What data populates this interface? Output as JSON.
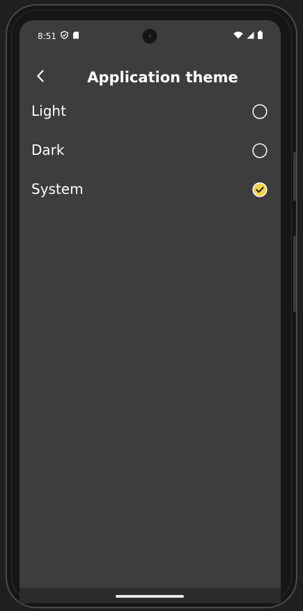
{
  "status_bar": {
    "time": "8:51",
    "left_icons": [
      "shield-icon",
      "sd-card-icon"
    ],
    "right_icons": [
      "wifi-icon",
      "signal-icon",
      "battery-icon"
    ]
  },
  "app_bar": {
    "back_icon": "chevron-left-icon",
    "title": "Application theme"
  },
  "options": [
    {
      "label": "Light",
      "selected": false
    },
    {
      "label": "Dark",
      "selected": false
    },
    {
      "label": "System",
      "selected": true
    }
  ],
  "colors": {
    "background": "#3d3d3d",
    "accent": "#f2d24b",
    "text": "#ffffff"
  }
}
